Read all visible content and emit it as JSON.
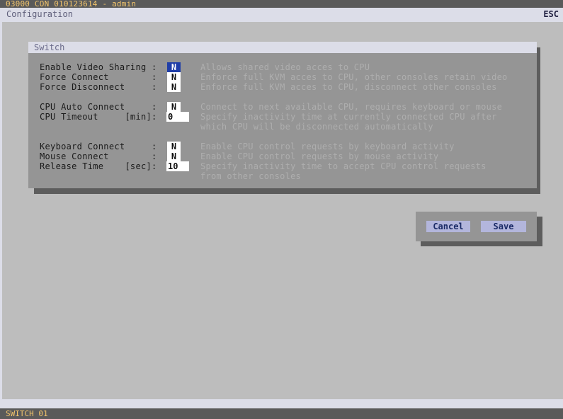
{
  "topbar": {
    "text": "03000 CON 010123614 - admin"
  },
  "titlebar": {
    "title": "Configuration",
    "esc_label": "ESC"
  },
  "panel": {
    "title": "Switch",
    "rows": [
      {
        "label": "Enable Video Sharing :",
        "value": "N",
        "description": "Allows shared video acces to CPU"
      },
      {
        "label": "Force Connect        :",
        "value": "N",
        "description": "Enforce full KVM acces to CPU, other consoles retain video"
      },
      {
        "label": "Force Disconnect     :",
        "value": "N",
        "description": "Enforce full KVM acces to CPU, disconnect other consoles"
      },
      {
        "label": "CPU Auto Connect     :",
        "value": "N",
        "description": "Connect to next available CPU, requires keyboard or mouse"
      },
      {
        "label": "CPU Timeout     [min]:",
        "value": "0",
        "description": "Specify inactivity time at currently connected CPU after",
        "description2": "which CPU will be disconnected automatically"
      },
      {
        "label": "Keyboard Connect     :",
        "value": "N",
        "description": "Enable CPU control requests by keyboard activity"
      },
      {
        "label": "Mouse Connect        :",
        "value": "N",
        "description": "Enable CPU control requests by mouse activity"
      },
      {
        "label": "Release Time    [sec]:",
        "value": "10",
        "description": "Specify inactivity time to accept CPU control requests",
        "description2": "from other consoles"
      }
    ]
  },
  "buttons": {
    "cancel": "Cancel",
    "save": "Save"
  },
  "status": {
    "text": "SWITCH 01"
  }
}
